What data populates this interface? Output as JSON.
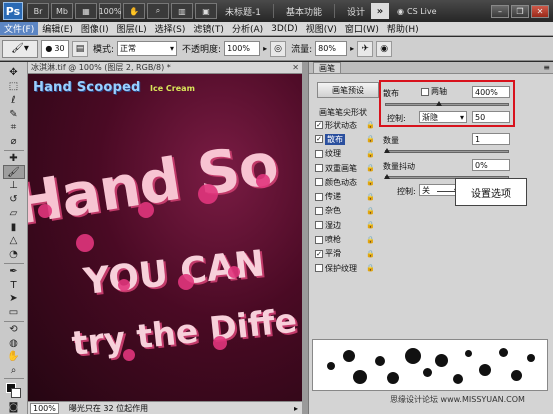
{
  "titlebar": {
    "app_logo": "Ps",
    "doc_name": "未标题-1",
    "workspace": "基本功能",
    "design": "设计",
    "more": "»",
    "cslive": "CS Live"
  },
  "menu": [
    "文件(F)",
    "编辑(E)",
    "图像(I)",
    "图层(L)",
    "选择(S)",
    "滤镜(T)",
    "分析(A)",
    "3D(D)",
    "视图(V)",
    "窗口(W)",
    "帮助(H)"
  ],
  "options": {
    "brush_size": "30",
    "mode_label": "模式:",
    "mode_value": "正常",
    "opacity_label": "不透明度:",
    "opacity_value": "100%",
    "flow_label": "流量:",
    "flow_value": "80%"
  },
  "document": {
    "tab_title": "冰淇淋.tif @ 100% (图层 2, RGB/8) *",
    "zoom": "100%",
    "status": "曝光只在 32 位起作用"
  },
  "artwork": {
    "title": "Hand Scooped",
    "subtitle": "Ice Cream",
    "line1": "Hand So",
    "line2": "YOU CAN",
    "line3": "try the Diffe"
  },
  "panel": {
    "tab": "画笔",
    "preset_button": "画笔预设",
    "list_header": "画笔笔尖形状",
    "items": [
      {
        "label": "形状动态",
        "checked": true
      },
      {
        "label": "散布",
        "checked": true,
        "selected": true
      },
      {
        "label": "纹理",
        "checked": false
      },
      {
        "label": "双重画笔",
        "checked": false
      },
      {
        "label": "颜色动态",
        "checked": false
      },
      {
        "label": "传递",
        "checked": false
      },
      {
        "label": "杂色",
        "checked": false
      },
      {
        "label": "湿边",
        "checked": false
      },
      {
        "label": "喷枪",
        "checked": false
      },
      {
        "label": "平滑",
        "checked": true
      },
      {
        "label": "保护纹理",
        "checked": false
      }
    ],
    "scatter_label": "散布",
    "both_axes_label": "两轴",
    "scatter_value": "400%",
    "control_label": "控制:",
    "control_value": "渐隐",
    "control_num": "50",
    "count_label": "数量",
    "count_value": "1",
    "count_jitter_label": "数量抖动",
    "count_jitter_value": "0%",
    "control2_label": "控制:",
    "control2_value": "关"
  },
  "callout": "设置选项",
  "watermark": "思缘设计论坛 www.MISSYUAN.COM",
  "colors": {
    "highlight_box": "#d8121c",
    "selection": "#2a4f9e"
  }
}
